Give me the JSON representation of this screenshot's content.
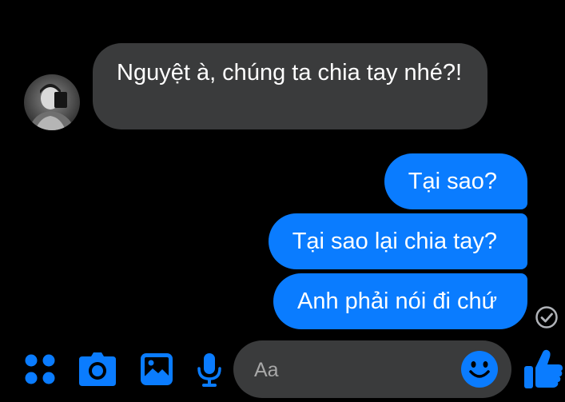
{
  "conversation": {
    "messages": [
      {
        "sender": "contact",
        "text": "Nguyệt à, chúng ta chia tay nhé?!"
      },
      {
        "sender": "me",
        "text": "Tại sao?"
      },
      {
        "sender": "me",
        "text": "Tại sao lại chia tay?"
      },
      {
        "sender": "me",
        "text": "Anh phải nói đi chứ"
      }
    ],
    "status_icon": "seen-check-icon"
  },
  "composer": {
    "placeholder": "Aa",
    "value": ""
  },
  "toolbar": {
    "icons": [
      "apps-icon",
      "camera-icon",
      "image-icon",
      "microphone-icon",
      "emoji-icon",
      "like-icon"
    ]
  },
  "colors": {
    "background": "#000000",
    "incoming_bubble": "#3a3b3c",
    "outgoing_bubble": "#0a7cff",
    "accent": "#0a7cff",
    "text": "#ffffff"
  }
}
